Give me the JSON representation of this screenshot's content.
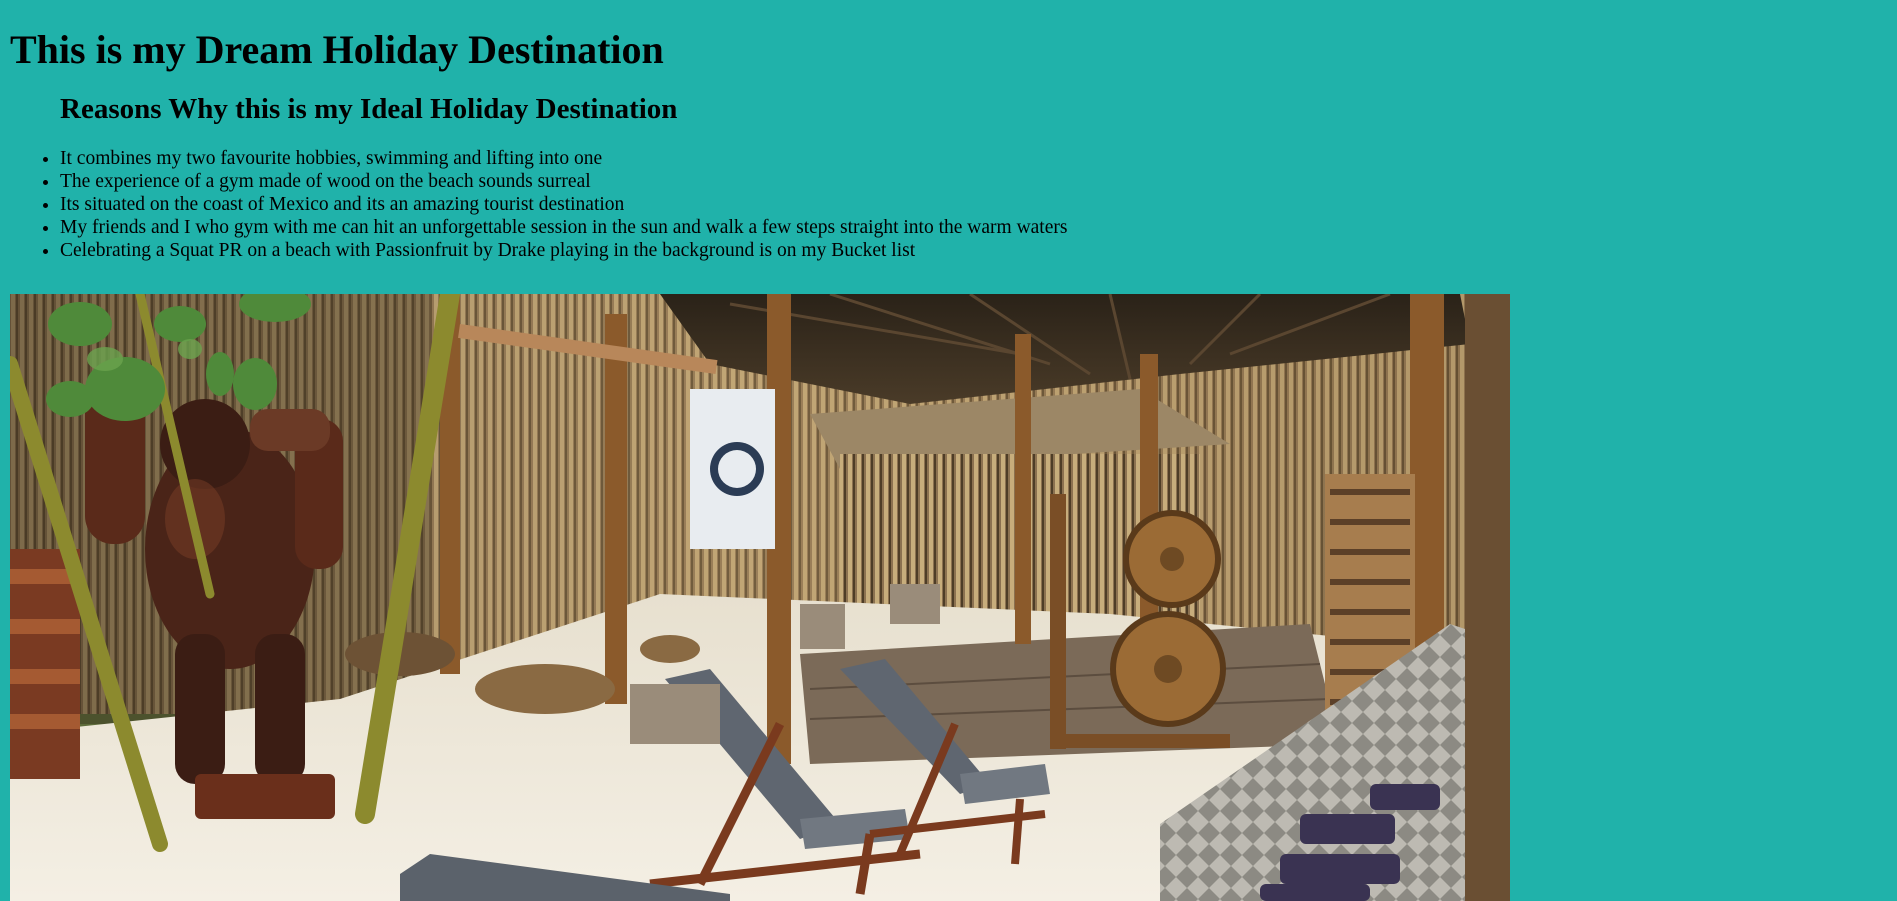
{
  "page": {
    "title": "This is my Dream Holiday Destination",
    "subtitle": "Reasons Why this is my Ideal Holiday Destination",
    "reasons": [
      "It combines my two favourite hobbies, swimming and lifting into one",
      "The experience of a gym made of wood on the beach sounds surreal",
      "Its situated on the coast of Mexico and its an amazing tourist destination",
      "My friends and I who gym with me can hit an unforgettable session in the sun and walk a few steps straight into the warm waters",
      "Celebrating a Squat PR on a beach with Passionfruit by Drake playing in the background is on my Bucket list"
    ]
  },
  "colors": {
    "background": "#20b2aa",
    "text": "#000000"
  },
  "image": {
    "icon": "beach-gym-photo"
  }
}
